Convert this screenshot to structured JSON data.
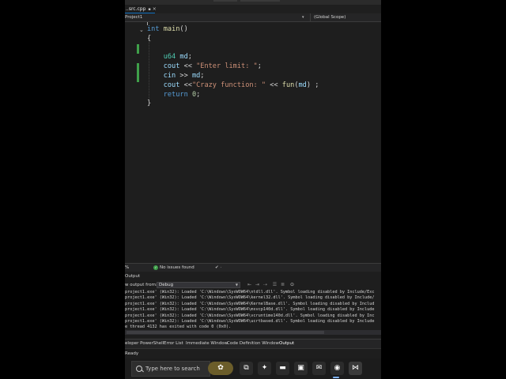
{
  "tab": {
    "filename": "..src.cpp",
    "pin": "▪",
    "close": "×"
  },
  "navbar": {
    "project": "Project1",
    "dropdown": "▾",
    "scope": "(Global Scope)"
  },
  "editor": {
    "lines": [
      {
        "tokens": [
          {
            "t": "int",
            "c": "kw"
          },
          {
            "t": " ",
            "c": "plain"
          },
          {
            "t": "main",
            "c": "fn"
          },
          {
            "t": "()",
            "c": "plain"
          }
        ]
      },
      {
        "tokens": [
          {
            "t": "{",
            "c": "plain"
          }
        ]
      },
      {
        "tokens": [
          {
            "t": "",
            "c": "plain"
          }
        ]
      },
      {
        "tokens": [
          {
            "t": "    ",
            "c": "plain"
          },
          {
            "t": "u64",
            "c": "typ"
          },
          {
            "t": " ",
            "c": "plain"
          },
          {
            "t": "md",
            "c": "var"
          },
          {
            "t": ";",
            "c": "plain"
          }
        ]
      },
      {
        "tokens": [
          {
            "t": "    ",
            "c": "plain"
          },
          {
            "t": "cout",
            "c": "var"
          },
          {
            "t": " << ",
            "c": "plain"
          },
          {
            "t": "\"Enter limit: \"",
            "c": "str"
          },
          {
            "t": ";",
            "c": "plain"
          }
        ]
      },
      {
        "tokens": [
          {
            "t": "    ",
            "c": "plain"
          },
          {
            "t": "cin",
            "c": "var"
          },
          {
            "t": " >> ",
            "c": "plain"
          },
          {
            "t": "md",
            "c": "var"
          },
          {
            "t": ";",
            "c": "plain"
          }
        ]
      },
      {
        "tokens": [
          {
            "t": "    ",
            "c": "plain"
          },
          {
            "t": "cout",
            "c": "var"
          },
          {
            "t": " <<",
            "c": "plain"
          },
          {
            "t": "\"Crazy function: \"",
            "c": "str"
          },
          {
            "t": " << ",
            "c": "plain"
          },
          {
            "t": "fun",
            "c": "fn"
          },
          {
            "t": "(",
            "c": "plain"
          },
          {
            "t": "md",
            "c": "var"
          },
          {
            "t": ") ;",
            "c": "plain"
          }
        ]
      },
      {
        "tokens": [
          {
            "t": "    ",
            "c": "plain"
          },
          {
            "t": "return",
            "c": "kw"
          },
          {
            "t": " ",
            "c": "plain"
          },
          {
            "t": "0",
            "c": "num"
          },
          {
            "t": ";",
            "c": "plain"
          }
        ]
      },
      {
        "tokens": [
          {
            "t": "}",
            "c": "plain"
          }
        ]
      }
    ]
  },
  "editstatus": {
    "zoom": "%",
    "issues": "No issues found",
    "brush": "✔ ·"
  },
  "output": {
    "title": "Output",
    "show_from_label": "w output from:",
    "source": "Debug",
    "lines": [
      "project1.exe' (Win32): Loaded 'C:\\Windows\\SysWOW64\\ntdll.dll'. Symbol loading disabled by Include/Exc",
      "project1.exe' (Win32): Loaded 'C:\\Windows\\SysWOW64\\kernel32.dll'. Symbol loading disabled by Include/",
      "project1.exe' (Win32): Loaded 'C:\\Windows\\SysWOW64\\KernelBase.dll'. Symbol loading disabled by Includ",
      "project1.exe' (Win32): Loaded 'C:\\Windows\\SysWOW64\\msvcp140d.dll'. Symbol loading disabled by Include",
      "project1.exe' (Win32): Loaded 'C:\\Windows\\SysWOW64\\vcruntime140d.dll'. Symbol loading disabled by Inc",
      "project1.exe' (Win32): Loaded 'C:\\Windows\\SysWOW64\\ucrtbased.dll'. Symbol loading disabled by Include",
      "e thread 4132 has exited with code 0 (0x0)."
    ]
  },
  "bottom_tabs": [
    {
      "label": "eloper PowerShell",
      "active": false
    },
    {
      "label": "Error List",
      "active": false
    },
    {
      "label": "Immediate Window",
      "active": false
    },
    {
      "label": "Code Definition Window",
      "active": false
    },
    {
      "label": "Output",
      "active": true
    }
  ],
  "statusbar": {
    "ready": "Ready"
  },
  "taskbar": {
    "search_placeholder": "Type here to search",
    "icons": [
      {
        "name": "task-view-icon",
        "glyph": "⧉",
        "color": "#2b2b2b"
      },
      {
        "name": "copilot-icon",
        "glyph": "✦",
        "color": "#2b2b2b"
      },
      {
        "name": "file-explorer-icon",
        "glyph": "▬",
        "color": "#2b2b2b"
      },
      {
        "name": "store-icon",
        "glyph": "▣",
        "color": "#2b2b2b"
      },
      {
        "name": "mail-icon",
        "glyph": "✉",
        "color": "#2b2b2b"
      },
      {
        "name": "chrome-icon",
        "glyph": "◉",
        "color": "#2b2b2b"
      },
      {
        "name": "visual-studio-icon",
        "glyph": "⋈",
        "color": "#3a3a3a"
      }
    ]
  },
  "colors": {
    "keyword": "#569cd6",
    "function": "#dcdcaa",
    "string": "#ce9178",
    "variable": "#9cdcfe",
    "type": "#4ec9b0",
    "number": "#b5cea8",
    "accent": "#0e70c0",
    "change_bar": "#3fa04a"
  }
}
